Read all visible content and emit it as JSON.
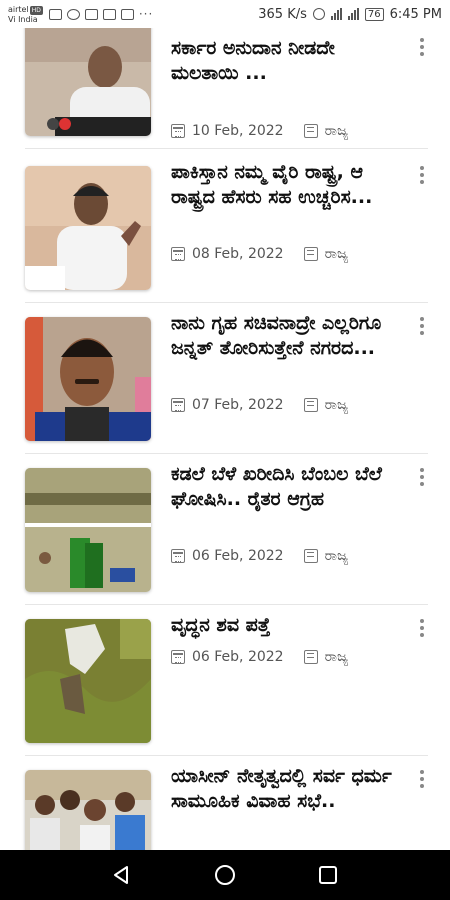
{
  "status_bar": {
    "carrier_line1": "airtel",
    "carrier_hd": "HD",
    "carrier_line2": "Vi India",
    "net_speed": "365 K/s",
    "battery": "76",
    "time": "6:45 PM"
  },
  "articles": [
    {
      "title": "ಸರ್ಕಾರ ಅನುದಾನ ನೀಡದೇ ಮಲತಾಯಿ ...",
      "date": "10 Feb, 2022",
      "category": "ರಾಜ್ಯ",
      "thumb": "politician-speaking"
    },
    {
      "title": "ಪಾಕಿಸ್ತಾನ ನಮ್ಮ ವೈರಿ ರಾಷ್ಟ್ರ, ಆ ರಾಷ್ಟ್ರದ ಹೆಸರು ಸಹ ಉಚ್ಚರಿಸ...",
      "date": "08 Feb, 2022",
      "category": "ರಾಜ್ಯ",
      "thumb": "politician-press"
    },
    {
      "title": "ನಾನು ಗೃಹ ಸಚಿವನಾದ್ರೇ ಎಲ್ಲರಿಗೂ ಜನ್ನತ್ ತೋರಿಸುತ್ತೇನೆ ನಗರದ...",
      "date": "07 Feb, 2022",
      "category": "ರಾಜ್ಯ",
      "thumb": "man-with-mics"
    },
    {
      "title": "ಕಡಲೆ ಬೆಳೆ ಖರೀದಿಸಿ ಬೆಂಬಲ ಬೆಲೆ ಘೋಷಿಸಿ.. ರೈತರ ಆಗ್ರಹ",
      "date": "06 Feb, 2022",
      "category": "ರಾಜ್ಯ",
      "thumb": "farmers-field"
    },
    {
      "title": "ವೃದ್ಧನ ಶವ ಪತ್ತೆ",
      "date": "06 Feb, 2022",
      "category": "ರಾಜ್ಯ",
      "thumb": "grass-field"
    },
    {
      "title": "ಯಾಸೀನ್ ನೇತೃತ್ವದಲ್ಲಿ ಸರ್ವ ಧರ್ಮ ಸಾಮೂಹಿಕ ವಿವಾಹ ಸಭೆ..",
      "date": "",
      "category": "",
      "thumb": "group-people"
    }
  ],
  "colors": {
    "text": "#111111",
    "meta": "#555555",
    "divider": "#e6e6e6",
    "navbar": "#000000"
  }
}
